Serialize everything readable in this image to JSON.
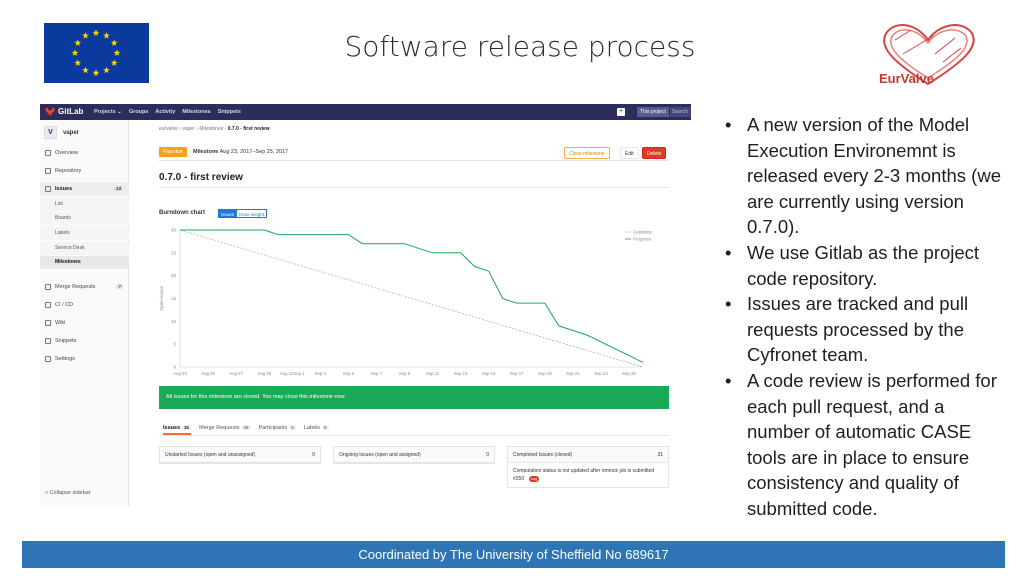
{
  "slide": {
    "title": "Software release process",
    "footer": "Coordinated by The University of Sheffield No 689617",
    "eurvalve_logo_text": "EurValve"
  },
  "bullets": [
    "A new version of the Model Execution Environemnt is released every 2-3 months (we are currently using version 0.7.0).",
    "We use Gitlab as the project code repository.",
    "Issues are tracked and pull requests processed by the Cyfronet team.",
    "A code review is performed for each pull request, and a number of automatic CASE tools are in place to ensure consistency and quality of submitted code."
  ],
  "gitlab": {
    "brand": "GitLab",
    "nav": [
      "Projects ⌄",
      "Groups",
      "Activity",
      "Milestones",
      "Snippets"
    ],
    "this_project": "This project",
    "search_placeholder": "Search",
    "project_avatar": "V",
    "project_name": "vaper",
    "sidebar": {
      "overview": "Overview",
      "repository": "Repository",
      "issues": "Issues",
      "issues_count": "13",
      "list": "List",
      "boards": "Boards",
      "labels": "Labels",
      "service_desk": "Service Desk",
      "milestones": "Milestones",
      "merge_requests": "Merge Requests",
      "merge_requests_count": "7",
      "ci_cd": "CI / CD",
      "wiki": "Wiki",
      "snippets": "Snippets",
      "settings": "Settings",
      "collapse": "« Collapse sidebar"
    },
    "breadcrumb": {
      "a": "eurvalve",
      "b": "vaper",
      "c": "Milestones",
      "d": "0.7.0 - first review"
    },
    "milestone": {
      "past_due": "Past due",
      "label": "Milestone",
      "dates": "Aug 23, 2017–Sep 25, 2017",
      "close_button": "Close milestone",
      "edit_button": "Edit",
      "delete_button": "Delete",
      "title": "0.7.0 - first review",
      "burndown_title": "Burndown chart",
      "toggle_issues": "Issues",
      "toggle_weight": "Issue weight",
      "closed_banner": "All issues for this milestone are closed. You may close this milestone now."
    },
    "tabs": [
      {
        "label": "Issues",
        "count": "31"
      },
      {
        "label": "Merge Requests",
        "count": "49"
      },
      {
        "label": "Participants",
        "count": "6"
      },
      {
        "label": "Labels",
        "count": "5"
      }
    ],
    "cards": {
      "unstarted_title": "Unstarted Issues (open and unassigned)",
      "unstarted_count": "0",
      "ongoing_title": "Ongoing Issues (open and assigned)",
      "ongoing_count": "0",
      "completed_title": "Completed Issues (closed)",
      "completed_count": "31",
      "completed_issue_text": "Computation status is not updated after rimrock job is submitted",
      "completed_issue_id": "#250",
      "completed_issue_label": "bug"
    }
  },
  "chart_data": {
    "type": "line",
    "title": "Burndown chart",
    "xlabel": "",
    "ylabel": "Open issues",
    "x": [
      "Aug 23",
      "Aug 25",
      "Aug 27",
      "Aug 29",
      "Aug 31",
      "Sep 2",
      "Sep 4",
      "Sep 6",
      "Sep 8",
      "Sep 10",
      "Sep 12",
      "Sep 14",
      "Sep 16",
      "Sep 18",
      "Sep 20",
      "Sep 22",
      "Sep 24"
    ],
    "x_tick_labels": [
      "Aug 23",
      "Aug 25",
      "Aug 27",
      "Aug 29",
      "Aug 31Sep 1",
      "Sep 3",
      "Sep 5",
      "Sep 7",
      "Sep 9",
      "Sep 11",
      "Sep 13",
      "Sep 15",
      "Sep 17",
      "Sep 19",
      "Sep 21",
      "Sep 23",
      "Sep 25"
    ],
    "y_ticks": [
      0,
      5,
      10,
      15,
      20,
      25,
      30
    ],
    "ylim": [
      0,
      30
    ],
    "legend_position": "top-right",
    "series": [
      {
        "name": "Guideline",
        "color": "#aaaaaa",
        "dashed": true,
        "x": [
          0,
          33
        ],
        "values": [
          30,
          0
        ]
      },
      {
        "name": "Progress",
        "color": "#1aaa55",
        "dashed": false,
        "x": [
          0,
          1,
          6,
          7,
          8,
          12,
          13,
          16,
          17,
          18,
          20,
          21,
          22,
          23,
          24,
          25,
          26,
          27,
          29,
          31,
          33
        ],
        "values": [
          30,
          30,
          30,
          29,
          29,
          29,
          27,
          27,
          26,
          25,
          25,
          22,
          21,
          15,
          14,
          14,
          14,
          9,
          7,
          4,
          1
        ]
      }
    ]
  }
}
